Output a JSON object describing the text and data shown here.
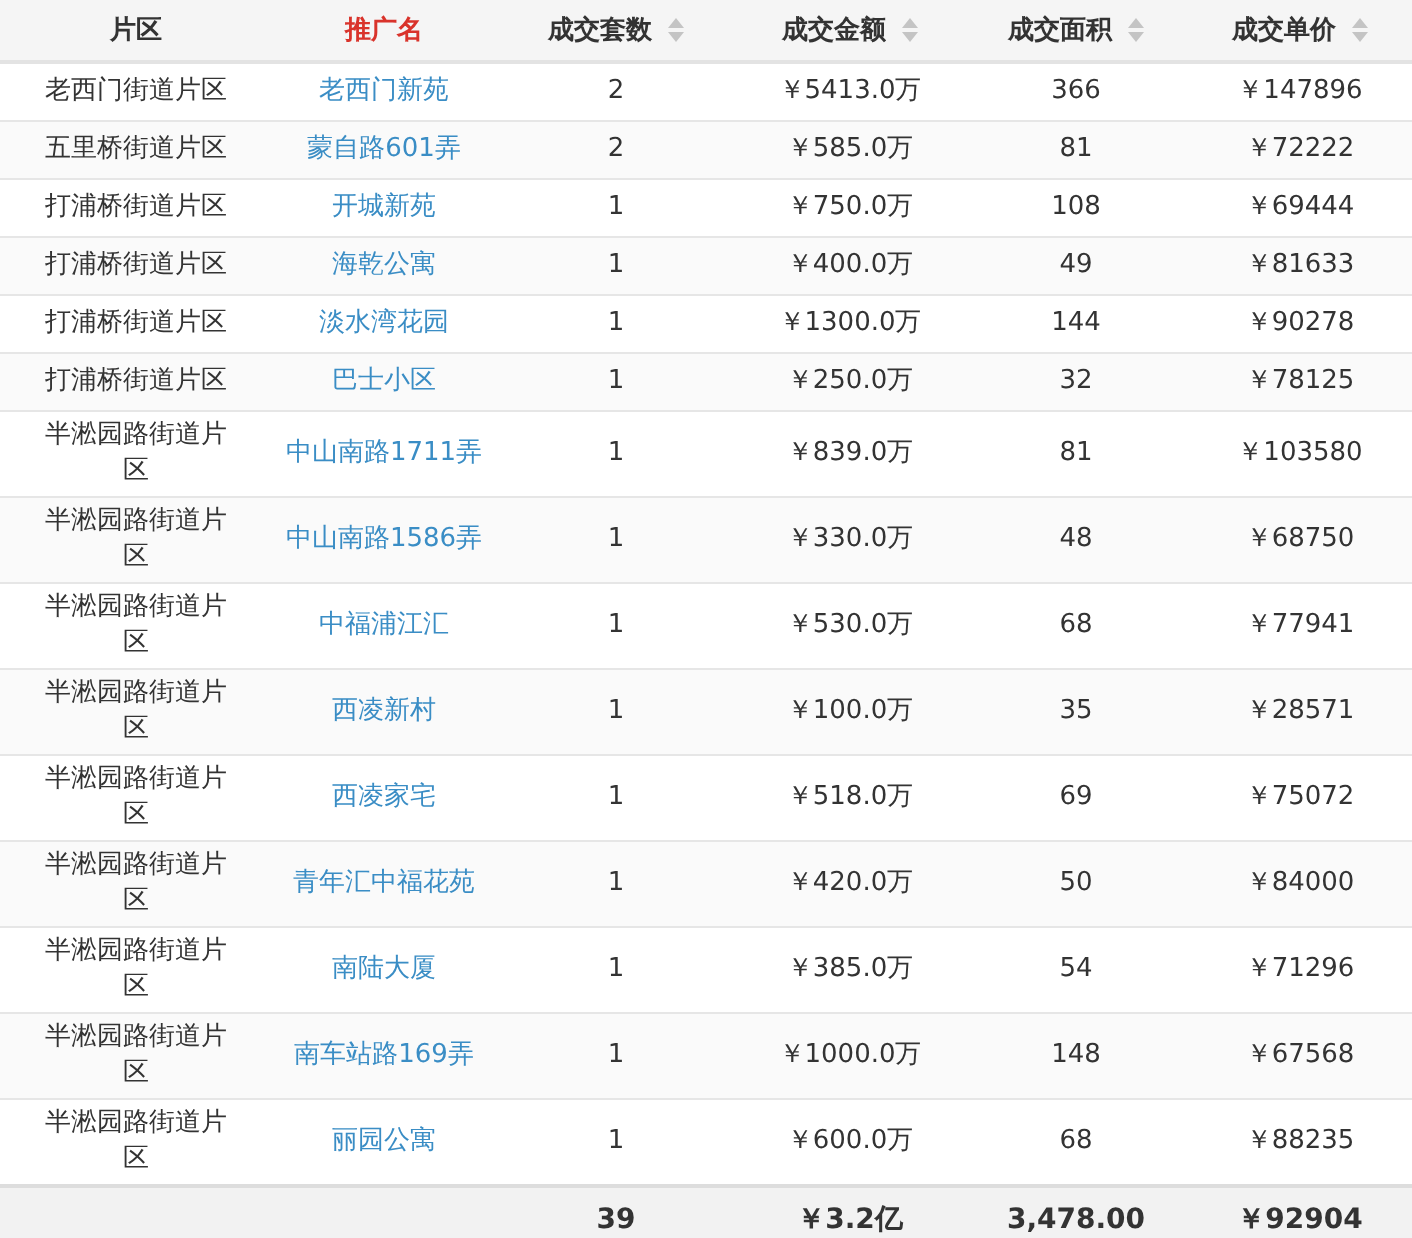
{
  "table": {
    "columns": [
      {
        "label": "片区",
        "sortable": false,
        "selected": false
      },
      {
        "label": "推广名",
        "sortable": false,
        "selected": true
      },
      {
        "label": "成交套数",
        "sortable": true,
        "selected": false
      },
      {
        "label": "成交金额",
        "sortable": true,
        "selected": false
      },
      {
        "label": "成交面积",
        "sortable": true,
        "selected": false
      },
      {
        "label": "成交单价",
        "sortable": true,
        "selected": false
      }
    ],
    "rows": [
      [
        "老西门街道片区",
        "老西门新苑",
        "2",
        "￥5413.0万",
        "366",
        "￥147896"
      ],
      [
        "五里桥街道片区",
        "蒙自路601弄",
        "2",
        "￥585.0万",
        "81",
        "￥72222"
      ],
      [
        "打浦桥街道片区",
        "开城新苑",
        "1",
        "￥750.0万",
        "108",
        "￥69444"
      ],
      [
        "打浦桥街道片区",
        "海乾公寓",
        "1",
        "￥400.0万",
        "49",
        "￥81633"
      ],
      [
        "打浦桥街道片区",
        "淡水湾花园",
        "1",
        "￥1300.0万",
        "144",
        "￥90278"
      ],
      [
        "打浦桥街道片区",
        "巴士小区",
        "1",
        "￥250.0万",
        "32",
        "￥78125"
      ],
      [
        "半淞园路街道片区",
        "中山南路1711弄",
        "1",
        "￥839.0万",
        "81",
        "￥103580"
      ],
      [
        "半淞园路街道片区",
        "中山南路1586弄",
        "1",
        "￥330.0万",
        "48",
        "￥68750"
      ],
      [
        "半淞园路街道片区",
        "中福浦江汇",
        "1",
        "￥530.0万",
        "68",
        "￥77941"
      ],
      [
        "半淞园路街道片区",
        "西凌新村",
        "1",
        "￥100.0万",
        "35",
        "￥28571"
      ],
      [
        "半淞园路街道片区",
        "西凌家宅",
        "1",
        "￥518.0万",
        "69",
        "￥75072"
      ],
      [
        "半淞园路街道片区",
        "青年汇中福花苑",
        "1",
        "￥420.0万",
        "50",
        "￥84000"
      ],
      [
        "半淞园路街道片区",
        "南陆大厦",
        "1",
        "￥385.0万",
        "54",
        "￥71296"
      ],
      [
        "半淞园路街道片区",
        "南车站路169弄",
        "1",
        "￥1000.0万",
        "148",
        "￥67568"
      ],
      [
        "半淞园路街道片区",
        "丽园公寓",
        "1",
        "￥600.0万",
        "68",
        "￥88235"
      ]
    ],
    "totals": [
      "39",
      "￥3.2亿",
      "3,478.00",
      "￥92904"
    ]
  }
}
